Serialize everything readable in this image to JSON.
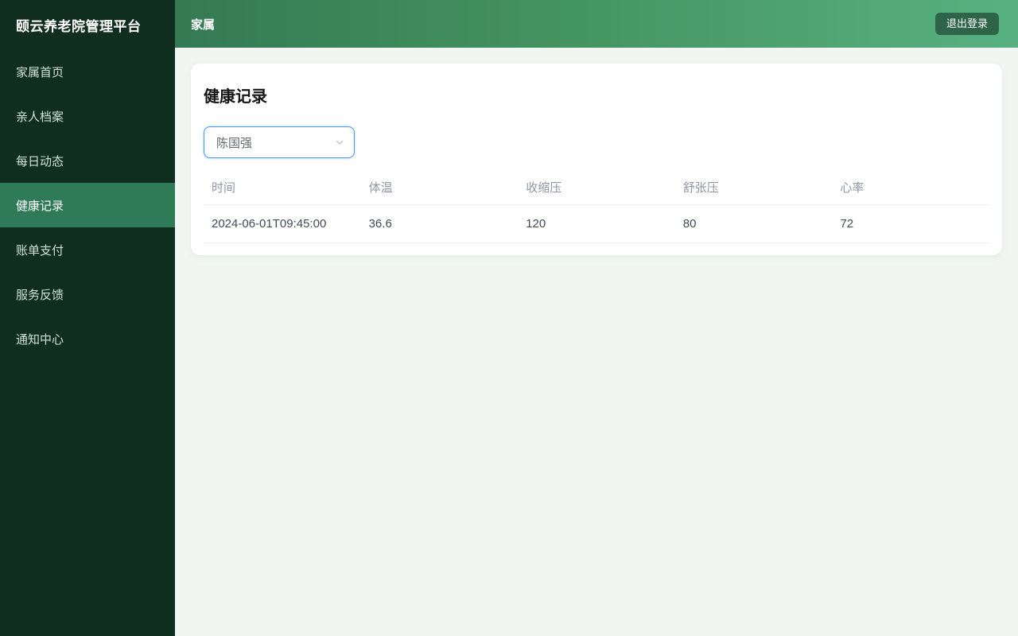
{
  "app": {
    "title": "颐云养老院管理平台"
  },
  "sidebar": {
    "items": [
      {
        "label": "家属首页",
        "active": false
      },
      {
        "label": "亲人档案",
        "active": false
      },
      {
        "label": "每日动态",
        "active": false
      },
      {
        "label": "健康记录",
        "active": true
      },
      {
        "label": "账单支付",
        "active": false
      },
      {
        "label": "服务反馈",
        "active": false
      },
      {
        "label": "通知中心",
        "active": false
      }
    ]
  },
  "header": {
    "title": "家属",
    "logout_label": "退出登录"
  },
  "main": {
    "card_title": "健康记录",
    "resident_select": {
      "value": "陈国强"
    },
    "table": {
      "columns": [
        "时间",
        "体温",
        "收缩压",
        "舒张压",
        "心率"
      ],
      "rows": [
        [
          "2024-06-01T09:45:00",
          "36.6",
          "120",
          "80",
          "72"
        ]
      ]
    }
  },
  "colors": {
    "sidebar_bg": "#0f2e20",
    "sidebar_active_bg": "#2f7b58",
    "header_gradient_start": "#347a54",
    "header_gradient_end": "#58b181",
    "logout_button_bg": "#2e6448",
    "select_focus_border": "#4096ff",
    "content_bg": "#f1f6f2"
  }
}
